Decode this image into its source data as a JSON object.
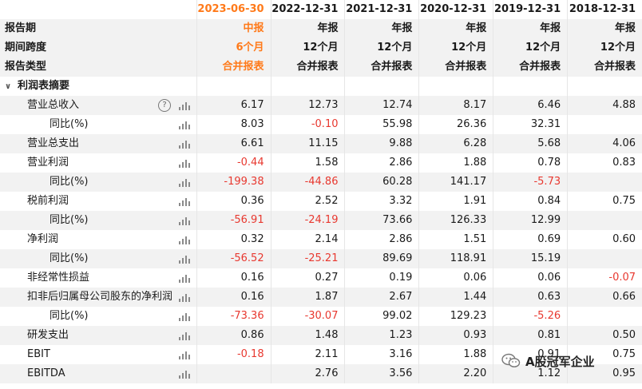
{
  "header": {
    "dates": [
      "2023-06-30",
      "2022-12-31",
      "2021-12-31",
      "2020-12-31",
      "2019-12-31",
      "2018-12-31"
    ],
    "rows": [
      {
        "label": "报告期",
        "values": [
          "中报",
          "年报",
          "年报",
          "年报",
          "年报",
          "年报"
        ]
      },
      {
        "label": "期间跨度",
        "values": [
          "6个月",
          "12个月",
          "12个月",
          "12个月",
          "12个月",
          "12个月"
        ]
      },
      {
        "label": "报告类型",
        "values": [
          "合并报表",
          "合并报表",
          "合并报表",
          "合并报表",
          "合并报表",
          "合并报表"
        ]
      }
    ]
  },
  "section": {
    "label": "利润表摘要"
  },
  "rows": [
    {
      "label": "营业总收入",
      "indent": 1,
      "help": true,
      "values": [
        "6.17",
        "12.73",
        "12.74",
        "8.17",
        "6.46",
        "4.88"
      ]
    },
    {
      "label": "同比(%)",
      "indent": 2,
      "values": [
        "8.03",
        "-0.10",
        "55.98",
        "26.36",
        "32.31",
        ""
      ]
    },
    {
      "label": "营业总支出",
      "indent": 1,
      "values": [
        "6.61",
        "11.15",
        "9.88",
        "6.28",
        "5.68",
        "4.06"
      ]
    },
    {
      "label": "营业利润",
      "indent": 1,
      "values": [
        "-0.44",
        "1.58",
        "2.86",
        "1.88",
        "0.78",
        "0.83"
      ]
    },
    {
      "label": "同比(%)",
      "indent": 2,
      "values": [
        "-199.38",
        "-44.86",
        "60.28",
        "141.17",
        "-5.73",
        ""
      ]
    },
    {
      "label": "税前利润",
      "indent": 1,
      "values": [
        "0.36",
        "2.52",
        "3.32",
        "1.91",
        "0.84",
        "0.75"
      ]
    },
    {
      "label": "同比(%)",
      "indent": 2,
      "values": [
        "-56.91",
        "-24.19",
        "73.66",
        "126.33",
        "12.99",
        ""
      ]
    },
    {
      "label": "净利润",
      "indent": 1,
      "values": [
        "0.32",
        "2.14",
        "2.86",
        "1.51",
        "0.69",
        "0.60"
      ]
    },
    {
      "label": "同比(%)",
      "indent": 2,
      "values": [
        "-56.52",
        "-25.21",
        "89.69",
        "118.91",
        "15.19",
        ""
      ]
    },
    {
      "label": "非经常性损益",
      "indent": 1,
      "values": [
        "0.16",
        "0.27",
        "0.19",
        "0.06",
        "0.06",
        "-0.07"
      ]
    },
    {
      "label": "扣非后归属母公司股东的净利润",
      "indent": 1,
      "values": [
        "0.16",
        "1.87",
        "2.67",
        "1.44",
        "0.63",
        "0.66"
      ]
    },
    {
      "label": "同比(%)",
      "indent": 2,
      "values": [
        "-73.36",
        "-30.07",
        "99.02",
        "129.23",
        "-5.26",
        ""
      ]
    },
    {
      "label": "研发支出",
      "indent": 1,
      "values": [
        "0.86",
        "1.48",
        "1.23",
        "0.93",
        "0.81",
        "0.50"
      ]
    },
    {
      "label": "EBIT",
      "indent": 1,
      "values": [
        "-0.18",
        "2.11",
        "3.16",
        "1.88",
        "0.91",
        "0.75"
      ]
    },
    {
      "label": "EBITDA",
      "indent": 1,
      "values": [
        "",
        "2.76",
        "3.56",
        "2.20",
        "1.12",
        "0.95"
      ]
    }
  ],
  "watermark": {
    "text": "A股冠军企业",
    "icon": "wechat-icon"
  },
  "colors": {
    "highlight": "#ff7a1a",
    "negative": "#e8382f",
    "stripe": "#f2f2f2"
  }
}
